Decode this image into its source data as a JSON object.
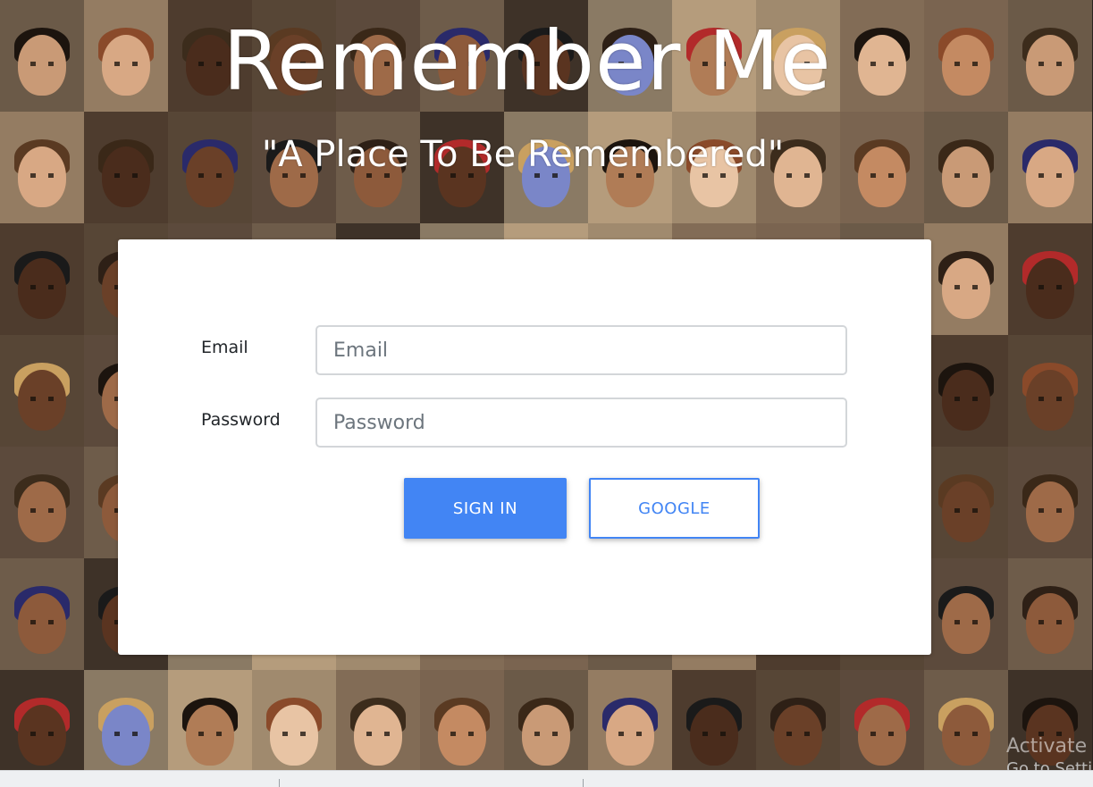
{
  "header": {
    "title": "Remember Me",
    "subtitle": "\"A Place To Be Remembered\""
  },
  "login_form": {
    "email_label": "Email",
    "email_placeholder": "Email",
    "email_value": "",
    "password_label": "Password",
    "password_placeholder": "Password",
    "password_value": "",
    "sign_in_label": "SIGN IN",
    "google_label": "GOOGLE"
  },
  "colors": {
    "primary": "#4285f4",
    "card_background": "#ffffff",
    "title_text": "#ffffff"
  },
  "os_watermark": {
    "line1": "Activate Windows",
    "line2": "Go to Settings"
  }
}
